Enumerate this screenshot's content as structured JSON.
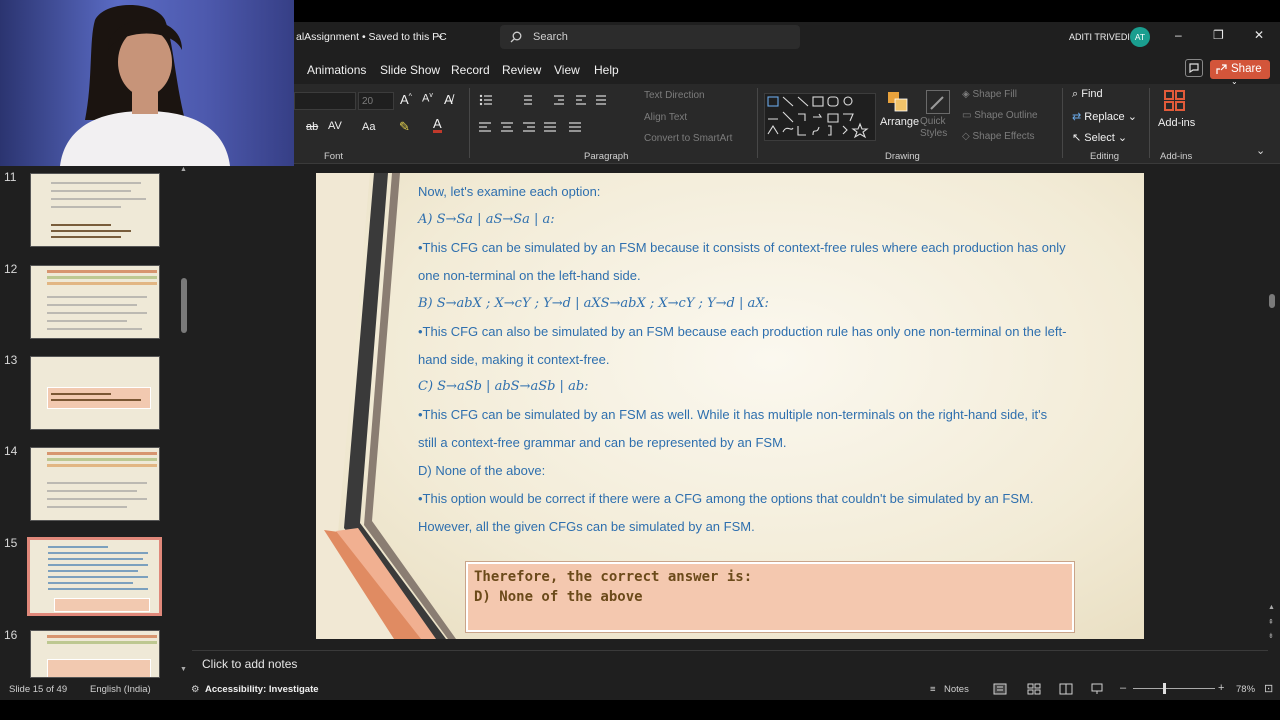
{
  "window": {
    "title": "alAssignment • Saved to this PC",
    "search_placeholder": "Search",
    "user_name": "ADITI TRIVEDI",
    "user_initials": "AT",
    "minimize": "–",
    "maximize": "❐",
    "close": "✕"
  },
  "ribbon_tabs": [
    "Animations",
    "Slide Show",
    "Record",
    "Review",
    "View",
    "Help"
  ],
  "share_label": "Share",
  "ribbon": {
    "font_size": "20",
    "font_group": "Font",
    "paragraph_group": "Paragraph",
    "text_direction": "Text Direction",
    "align_text": "Align Text",
    "convert_smartart": "Convert to SmartArt",
    "drawing_group": "Drawing",
    "arrange": "Arrange",
    "quick_styles": "Quick Styles",
    "shape_fill": "Shape Fill",
    "shape_outline": "Shape Outline",
    "shape_effects": "Shape Effects",
    "find": "Find",
    "replace": "Replace",
    "select": "Select",
    "editing_group": "Editing",
    "addins": "Add-ins",
    "addins_group": "Add-ins"
  },
  "thumbnails": [
    {
      "num": "11"
    },
    {
      "num": "12"
    },
    {
      "num": "13"
    },
    {
      "num": "14"
    },
    {
      "num": "15"
    },
    {
      "num": "16"
    }
  ],
  "slide": {
    "lines": [
      "Now, let's examine each option:",
      "A) S→Sa | aS→Sa | a:",
      "•This CFG can be simulated by an FSM because it consists of context-free rules where each production has only",
      "one non-terminal on the left-hand side.",
      "B) S→abX ; X→cY ; Y→d | aXS→abX ; X→cY ; Y→d | aX:",
      "•This CFG can also be simulated by an FSM because each production rule has only one non-terminal on the left-",
      "hand side, making it context-free.",
      "C) S→aSb | abS→aSb | ab:",
      "•This CFG can be simulated by an FSM as well. While it has multiple non-terminals on the right-hand side, it's",
      "still a context-free grammar and can be represented by an FSM.",
      "D) None of the above:",
      "•This option would be correct if there were a CFG among the options that couldn't be simulated by an FSM.",
      "However, all the given CFGs can be simulated by an FSM."
    ],
    "answer_line1": "Therefore, the correct answer is:",
    "answer_line2": "D) None of the above"
  },
  "notes_placeholder": "Click to add notes",
  "status": {
    "slide_counter": "Slide 15 of 49",
    "language": "English (India)",
    "accessibility": "Accessibility: Investigate",
    "notes": "Notes",
    "zoom": "78%"
  },
  "colors": {
    "accent": "#d3553a",
    "slide_text": "#2e6fae",
    "answer_box": "#f4c8af",
    "avatar": "#1a9e8f"
  }
}
